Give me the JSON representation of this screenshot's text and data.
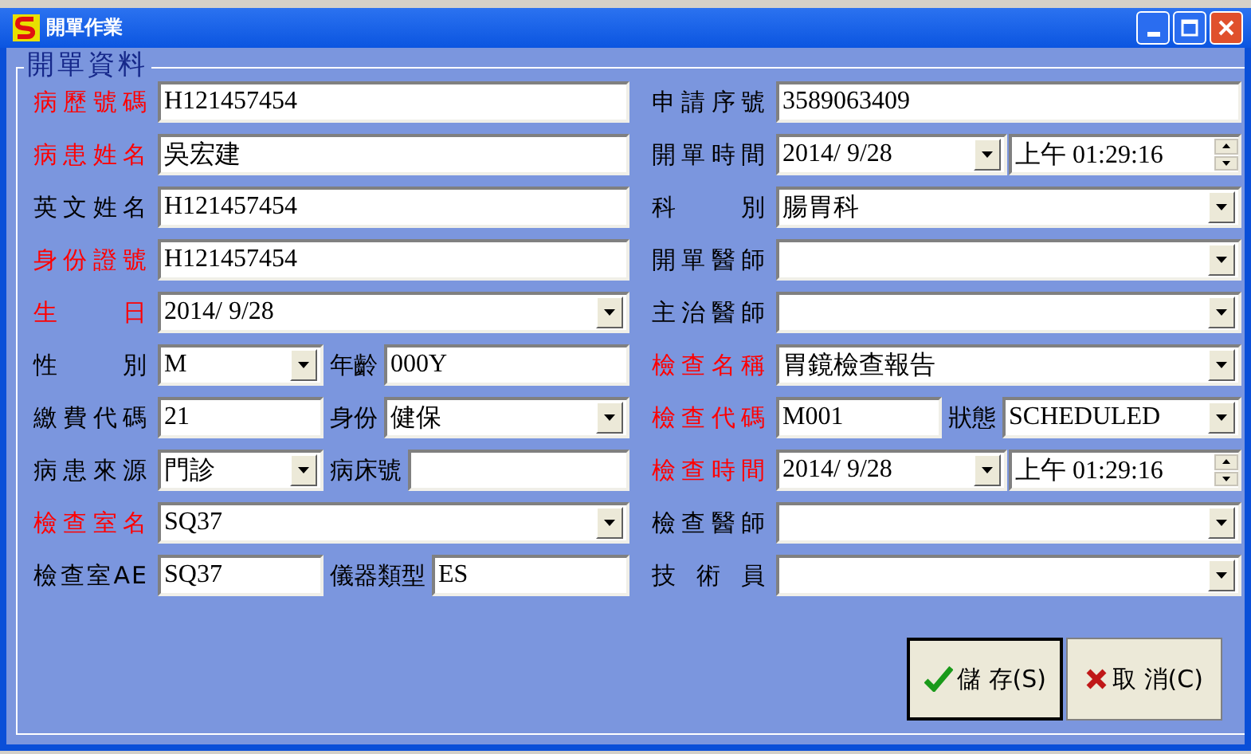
{
  "window": {
    "title": "開單作業"
  },
  "group": {
    "title": "開單資料"
  },
  "left_rows": [
    {
      "label": "病歷號碼",
      "required": true,
      "field": {
        "kind": "text",
        "value": "H121457454"
      }
    },
    {
      "label": "病患姓名",
      "required": true,
      "field": {
        "kind": "text",
        "value": "吳宏建"
      }
    },
    {
      "label": "英文姓名",
      "required": false,
      "field": {
        "kind": "text",
        "value": "H121457454"
      }
    },
    {
      "label": "身份證號",
      "required": true,
      "field": {
        "kind": "text",
        "value": "H121457454"
      }
    },
    {
      "label": "生 日",
      "required": true,
      "field": {
        "kind": "combo",
        "value": "2014/ 9/28"
      }
    },
    {
      "label": "性 別",
      "required": false,
      "field": {
        "kind": "combo",
        "value": "M"
      },
      "extra": {
        "label": "年齡",
        "required": false,
        "field": {
          "kind": "text",
          "value": "000Y"
        }
      }
    },
    {
      "label": "繳費代碼",
      "required": false,
      "field": {
        "kind": "text",
        "value": "21"
      },
      "extra": {
        "label": "身份",
        "required": false,
        "field": {
          "kind": "combo",
          "value": "健保"
        }
      }
    },
    {
      "label": "病患來源",
      "required": false,
      "field": {
        "kind": "combo",
        "value": "門診"
      },
      "extra": {
        "label": "病床號",
        "required": false,
        "field": {
          "kind": "text"
        }
      }
    },
    {
      "label": "檢查室名",
      "required": true,
      "field": {
        "kind": "combo",
        "value": "SQ37"
      }
    },
    {
      "label": "檢查室AE",
      "required": false,
      "field": {
        "kind": "text",
        "value": "SQ37"
      },
      "extra": {
        "label": "儀器類型",
        "required": false,
        "field": {
          "kind": "text",
          "value": "ES"
        }
      }
    }
  ],
  "right_rows": [
    {
      "label": "申請序號",
      "required": false,
      "field": {
        "kind": "text",
        "value": "3589063409"
      }
    },
    {
      "label": "開單時間",
      "required": false,
      "field": {
        "kind": "datetime",
        "value": "2014/ 9/28",
        "time": "上午 01:29:16"
      }
    },
    {
      "label": "科 別",
      "required": false,
      "field": {
        "kind": "combo",
        "value": "腸胃科"
      }
    },
    {
      "label": "開單醫師",
      "required": false,
      "field": {
        "kind": "combo"
      }
    },
    {
      "label": "主治醫師",
      "required": false,
      "field": {
        "kind": "combo"
      }
    },
    {
      "label": "檢查名稱",
      "required": true,
      "field": {
        "kind": "combo",
        "value": "胃鏡檢查報告"
      }
    },
    {
      "label": "檢查代碼",
      "required": true,
      "field": {
        "kind": "text",
        "value": "M001"
      },
      "extra": {
        "label": "狀態",
        "required": false,
        "field": {
          "kind": "combo",
          "value": "SCHEDULED"
        }
      }
    },
    {
      "label": "檢查時間",
      "required": true,
      "field": {
        "kind": "datetime",
        "value": "2014/ 9/28",
        "time": "上午 01:29:16"
      }
    },
    {
      "label": "檢查醫師",
      "required": false,
      "field": {
        "kind": "combo"
      }
    },
    {
      "label": "技 術 員",
      "required": false,
      "field": {
        "kind": "combo"
      }
    }
  ],
  "buttons": [
    {
      "kind": "save",
      "label": "儲 存(S)"
    },
    {
      "kind": "cancel",
      "label": "取 消(C)"
    }
  ]
}
